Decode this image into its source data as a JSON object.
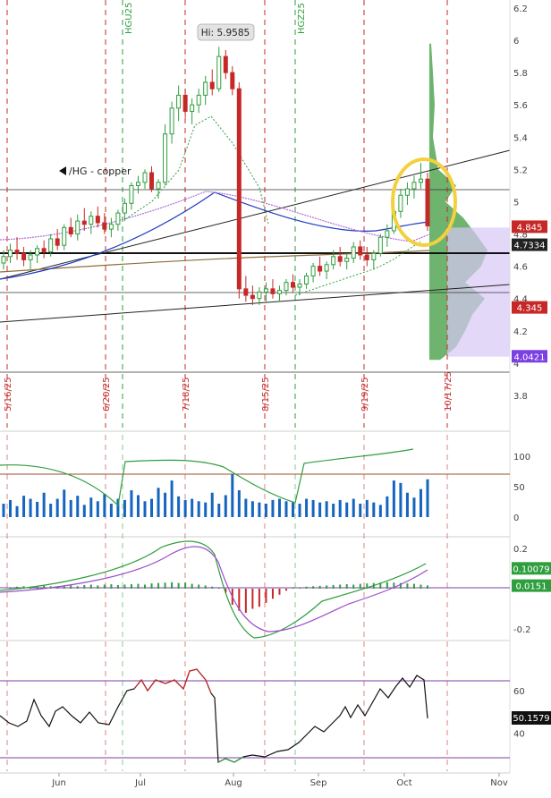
{
  "chart_data": [
    {
      "panel": "price",
      "type": "candlestick",
      "symbol_label": "/HG - copper",
      "ylim": [
        3.6,
        6.25
      ],
      "y_ticks": [
        "6.2",
        "6",
        "5.8",
        "5.6",
        "5.4",
        "5.2",
        "5",
        "4.8",
        "4.6",
        "4.4",
        "4.2",
        "4",
        "3.8"
      ],
      "y_tick_values": [
        6.2,
        6.0,
        5.8,
        5.6,
        5.4,
        5.2,
        5.0,
        4.8,
        4.6,
        4.4,
        4.2,
        4.0,
        3.8
      ],
      "high_annotation": {
        "label": "Hi: 5.9585",
        "value": 5.9585
      },
      "price_labels": [
        {
          "text": "4.845",
          "value": 4.845,
          "color": "#c62828"
        },
        {
          "text": "4.7334",
          "value": 4.7334,
          "color": "#222222"
        },
        {
          "text": "4.345",
          "value": 4.345,
          "color": "#c62828"
        },
        {
          "text": "4.0421",
          "value": 4.0421,
          "color": "#7b3fe4"
        }
      ],
      "expiry_labels": [
        "HGU25",
        "HGZ25"
      ],
      "cycle_date_labels": [
        "5/16/25",
        "6/20/25",
        "7/18/25",
        "8/15/25",
        "9/19/25",
        "10/17/25"
      ],
      "candles": [
        [
          4.62,
          4.7,
          4.58,
          4.66
        ],
        [
          4.66,
          4.74,
          4.62,
          4.7
        ],
        [
          4.7,
          4.78,
          4.64,
          4.68
        ],
        [
          4.68,
          4.72,
          4.6,
          4.64
        ],
        [
          4.64,
          4.7,
          4.58,
          4.67
        ],
        [
          4.67,
          4.73,
          4.62,
          4.71
        ],
        [
          4.71,
          4.76,
          4.65,
          4.69
        ],
        [
          4.69,
          4.8,
          4.66,
          4.77
        ],
        [
          4.77,
          4.83,
          4.7,
          4.73
        ],
        [
          4.73,
          4.86,
          4.7,
          4.84
        ],
        [
          4.84,
          4.9,
          4.78,
          4.8
        ],
        [
          4.8,
          4.92,
          4.76,
          4.88
        ],
        [
          4.88,
          4.96,
          4.82,
          4.86
        ],
        [
          4.86,
          4.94,
          4.8,
          4.91
        ],
        [
          4.91,
          4.97,
          4.84,
          4.87
        ],
        [
          4.87,
          4.93,
          4.8,
          4.83
        ],
        [
          4.83,
          4.9,
          4.78,
          4.86
        ],
        [
          4.86,
          4.95,
          4.82,
          4.93
        ],
        [
          4.93,
          5.02,
          4.88,
          4.99
        ],
        [
          4.99,
          5.12,
          4.95,
          5.1
        ],
        [
          5.1,
          5.16,
          5.05,
          5.12
        ],
        [
          5.12,
          5.2,
          5.08,
          5.18
        ],
        [
          5.18,
          5.22,
          5.06,
          5.08
        ],
        [
          5.08,
          5.14,
          5.02,
          5.12
        ],
        [
          5.12,
          5.48,
          5.1,
          5.42
        ],
        [
          5.42,
          5.62,
          5.36,
          5.58
        ],
        [
          5.58,
          5.72,
          5.5,
          5.66
        ],
        [
          5.66,
          5.7,
          5.52,
          5.56
        ],
        [
          5.56,
          5.64,
          5.48,
          5.6
        ],
        [
          5.6,
          5.7,
          5.55,
          5.66
        ],
        [
          5.66,
          5.78,
          5.6,
          5.74
        ],
        [
          5.74,
          5.82,
          5.66,
          5.7
        ],
        [
          5.7,
          5.96,
          5.68,
          5.9
        ],
        [
          5.9,
          5.94,
          5.76,
          5.8
        ],
        [
          5.8,
          5.84,
          5.66,
          5.7
        ],
        [
          5.7,
          5.74,
          4.4,
          4.46
        ],
        [
          4.46,
          4.54,
          4.38,
          4.42
        ],
        [
          4.42,
          4.48,
          4.36,
          4.4
        ],
        [
          4.4,
          4.47,
          4.36,
          4.44
        ],
        [
          4.44,
          4.5,
          4.38,
          4.46
        ],
        [
          4.46,
          4.52,
          4.4,
          4.43
        ],
        [
          4.43,
          4.48,
          4.38,
          4.45
        ],
        [
          4.45,
          4.52,
          4.42,
          4.5
        ],
        [
          4.5,
          4.55,
          4.44,
          4.47
        ],
        [
          4.47,
          4.52,
          4.42,
          4.49
        ],
        [
          4.49,
          4.56,
          4.46,
          4.54
        ],
        [
          4.54,
          4.62,
          4.5,
          4.6
        ],
        [
          4.6,
          4.66,
          4.54,
          4.57
        ],
        [
          4.57,
          4.63,
          4.52,
          4.61
        ],
        [
          4.61,
          4.7,
          4.58,
          4.66
        ],
        [
          4.66,
          4.72,
          4.6,
          4.63
        ],
        [
          4.63,
          4.68,
          4.58,
          4.65
        ],
        [
          4.65,
          4.75,
          4.62,
          4.72
        ],
        [
          4.72,
          4.76,
          4.64,
          4.67
        ],
        [
          4.67,
          4.72,
          4.6,
          4.64
        ],
        [
          4.64,
          4.7,
          4.58,
          4.68
        ],
        [
          4.68,
          4.8,
          4.66,
          4.78
        ],
        [
          4.78,
          4.86,
          4.72,
          4.82
        ],
        [
          4.82,
          4.96,
          4.8,
          4.94
        ],
        [
          4.94,
          5.08,
          4.9,
          5.04
        ],
        [
          5.04,
          5.12,
          4.98,
          5.08
        ],
        [
          5.08,
          5.16,
          5.02,
          5.12
        ],
        [
          5.12,
          5.24,
          5.08,
          5.14
        ],
        [
          5.14,
          5.18,
          4.82,
          4.85
        ]
      ],
      "annotation": {
        "type": "ellipse",
        "color": "#f4d03f",
        "around": "recent high"
      },
      "overlays": [
        "trendlines",
        "moving averages",
        "volume profile"
      ]
    },
    {
      "panel": "volume_oscillator",
      "type": "bar",
      "ylim": [
        0,
        135
      ],
      "y_ticks": [
        "100",
        "50",
        "0"
      ],
      "y_tick_values": [
        100,
        50,
        0
      ]
    },
    {
      "panel": "macd",
      "type": "line",
      "ylim": [
        -0.24,
        0.24
      ],
      "y_ticks": [
        "0.2",
        "-0.2"
      ],
      "y_tick_values": [
        0.2,
        -0.2
      ],
      "value_labels": [
        {
          "text": "0.10079",
          "value": 0.10079,
          "color": "#2e9e3e"
        },
        {
          "text": "0.0151",
          "value": 0.0151,
          "color": "#2e9e3e"
        }
      ]
    },
    {
      "panel": "rsi",
      "type": "line",
      "ylim": [
        22,
        82
      ],
      "y_ticks": [
        "60",
        "40"
      ],
      "y_tick_values": [
        60,
        40
      ],
      "last_value_label": "50.1579",
      "last_value": 50.1579
    }
  ],
  "x_axis": {
    "months": [
      "Jun",
      "Jul",
      "Aug",
      "Sep",
      "Oct",
      "Nov"
    ]
  },
  "colors": {
    "up": "#2e9e3e",
    "down": "#c62828",
    "cycle_line": "#c62828",
    "expiry_line": "#2e9e3e",
    "volume": "#1565c0",
    "signal": "#9c4dcc"
  }
}
